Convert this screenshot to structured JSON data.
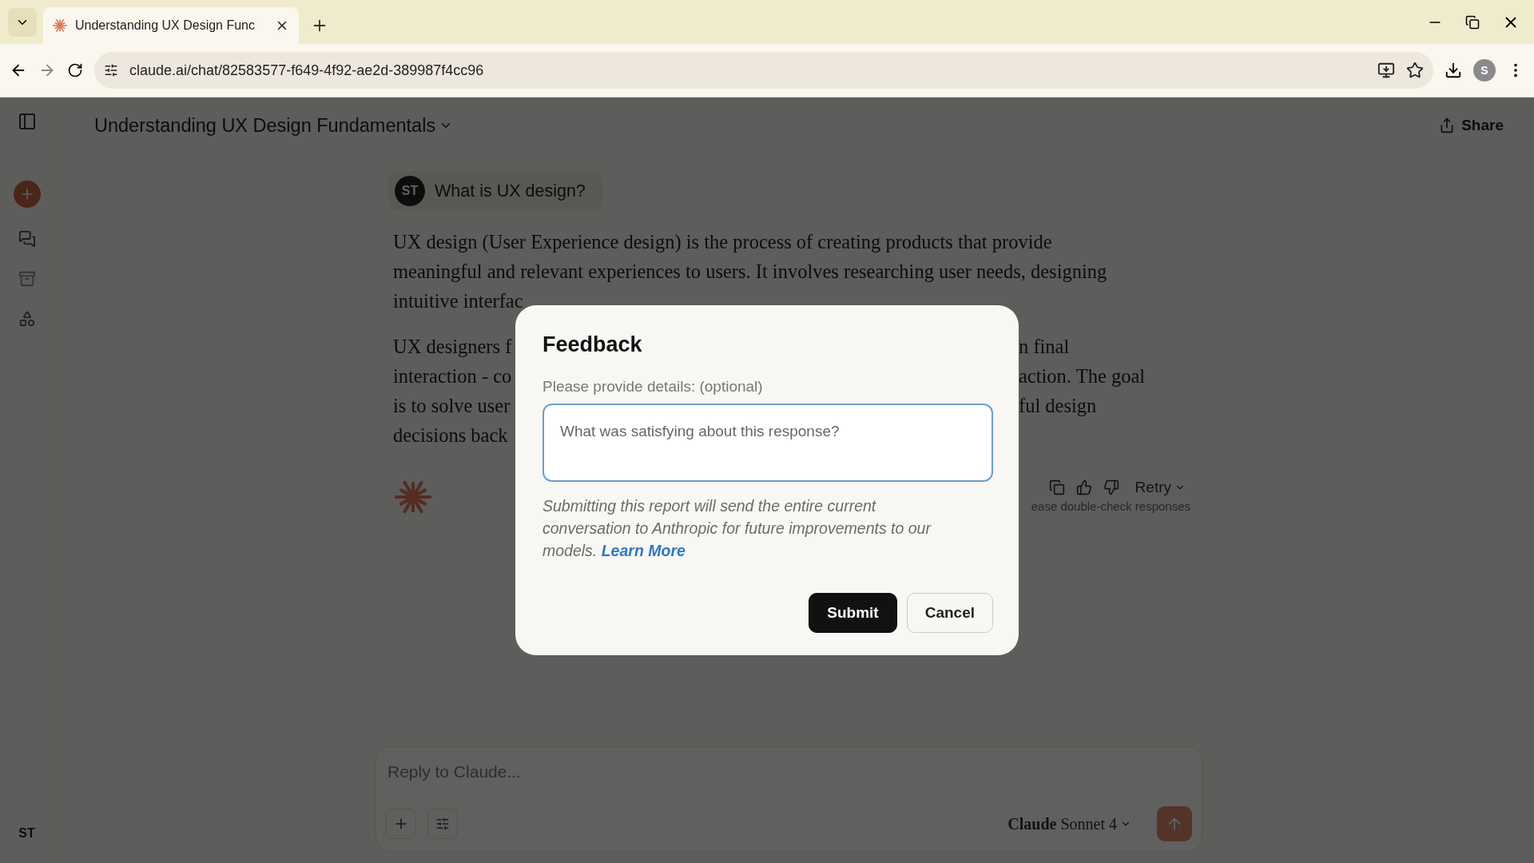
{
  "browser": {
    "tab_title": "Understanding UX Design Func",
    "url": "claude.ai/chat/82583577-f649-4f92-ae2d-389987f4cc96",
    "profile": "S"
  },
  "header": {
    "title": "Understanding UX Design Fundamentals",
    "share": "Share"
  },
  "sidebar": {
    "avatar": "ST"
  },
  "conversation": {
    "user_avatar": "ST",
    "user_message": "What is UX design?",
    "paragraphs": [
      [
        {
          "left": "UX design (User Experience design) is the process of creating products that provide"
        },
        {
          "left": "meaningful and relevant experiences to users. It involves researching user needs, designing"
        },
        {
          "left": "intuitive interfac"
        }
      ],
      [
        {
          "left": "UX designers f",
          "right": "n final"
        },
        {
          "left": "interaction - co",
          "right": "action. The goal"
        },
        {
          "left": "is to solve user",
          "right": "ful design"
        },
        {
          "left": "decisions back"
        }
      ]
    ],
    "retry": "Retry",
    "disclaimer": "ease double-check responses"
  },
  "composer": {
    "placeholder": "Reply to Claude...",
    "model": "**Claude** Sonnet 4"
  },
  "dialog": {
    "title": "Feedback",
    "label": "Please provide details: (optional)",
    "placeholder": "What was satisfying about this response?",
    "note": "Submitting this report will send the entire current conversation to Anthropic for future improvements to our models.",
    "link": "Learn More",
    "submit": "Submit",
    "cancel": "Cancel"
  }
}
